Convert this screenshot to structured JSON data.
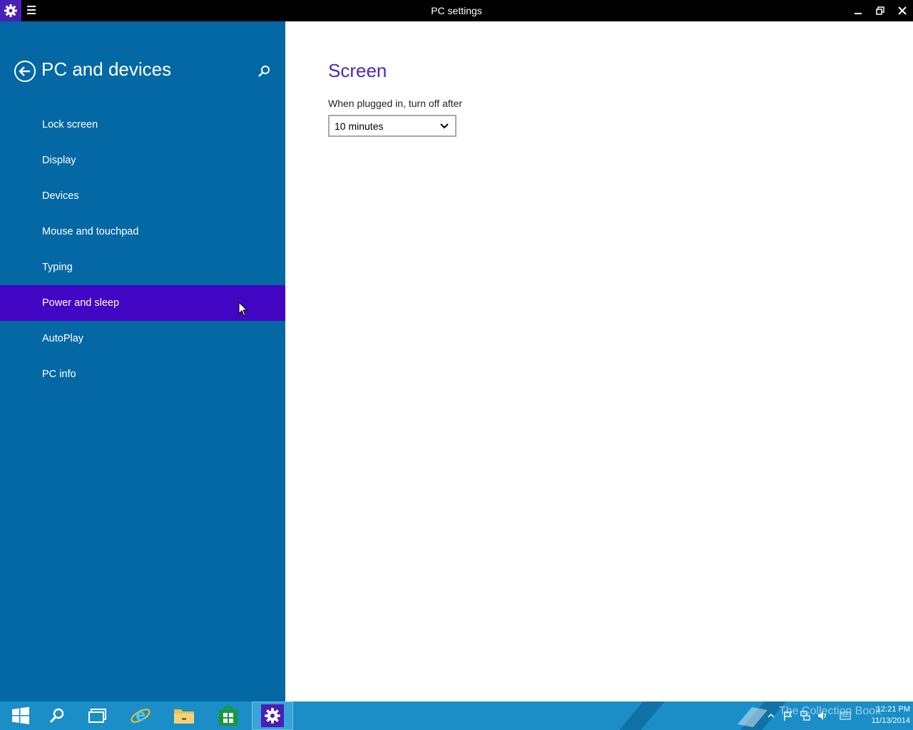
{
  "window": {
    "title": "PC settings"
  },
  "sidebar": {
    "title": "PC and devices",
    "items": [
      {
        "label": "Lock screen"
      },
      {
        "label": "Display"
      },
      {
        "label": "Devices"
      },
      {
        "label": "Mouse and touchpad"
      },
      {
        "label": "Typing"
      },
      {
        "label": "Power and sleep",
        "selected": true
      },
      {
        "label": "AutoPlay"
      },
      {
        "label": "PC info"
      }
    ]
  },
  "content": {
    "section_title": "Screen",
    "field_label": "When plugged in, turn off after",
    "select_value": "10 minutes"
  },
  "taskbar": {
    "apps": [
      "start-icon",
      "search-icon",
      "task-view-icon",
      "internet-explorer-icon",
      "file-explorer-icon",
      "store-icon",
      "settings-icon"
    ],
    "active_app": "settings-icon",
    "clock_time": "12:21 PM",
    "clock_date": "11/13/2014",
    "watermark": "The Collection Book"
  },
  "colors": {
    "sidebar": "#0368a3",
    "selected": "#4305c4",
    "accent_text": "#4b29b8",
    "taskbar": "#1b8ec7",
    "titlebar": "#000000"
  }
}
